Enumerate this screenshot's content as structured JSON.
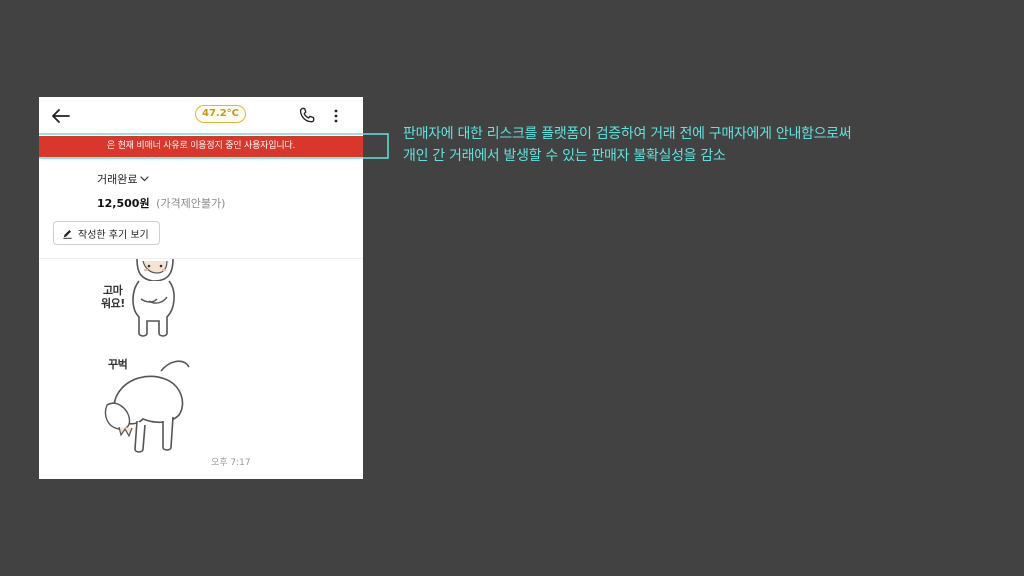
{
  "header": {
    "temperature": "47.2°C"
  },
  "warning": {
    "text": "은 현재 비매너 사유로 이용정지 중인 사용자입니다."
  },
  "product": {
    "status": "거래완료",
    "price": "12,500원",
    "price_note": "(가격제안불가)"
  },
  "review_button": {
    "label": "작성한 후기 보기"
  },
  "chat": {
    "sticker1_text": [
      "고마",
      "워요!"
    ],
    "sticker2_text": "꾸벅",
    "timestamp": "오후 7:17"
  },
  "annotation": {
    "line1": "판매자에 대한 리스크를 플랫폼이 검증하여 거래 전에 구매자에게 안내함으로써",
    "line2": "개인 간 거래에서 발생할 수 있는 판매자 불확실성을 감소"
  },
  "colors": {
    "background": "#424242",
    "warning_red": "#d9372b",
    "temperature": "#c9961a",
    "annotation_teal": "#5fe3dd"
  },
  "icons": {
    "back": "arrow-left-icon",
    "call": "phone-icon",
    "more": "more-vertical-icon",
    "status_dropdown": "chevron-down-icon",
    "review": "pencil-icon"
  }
}
